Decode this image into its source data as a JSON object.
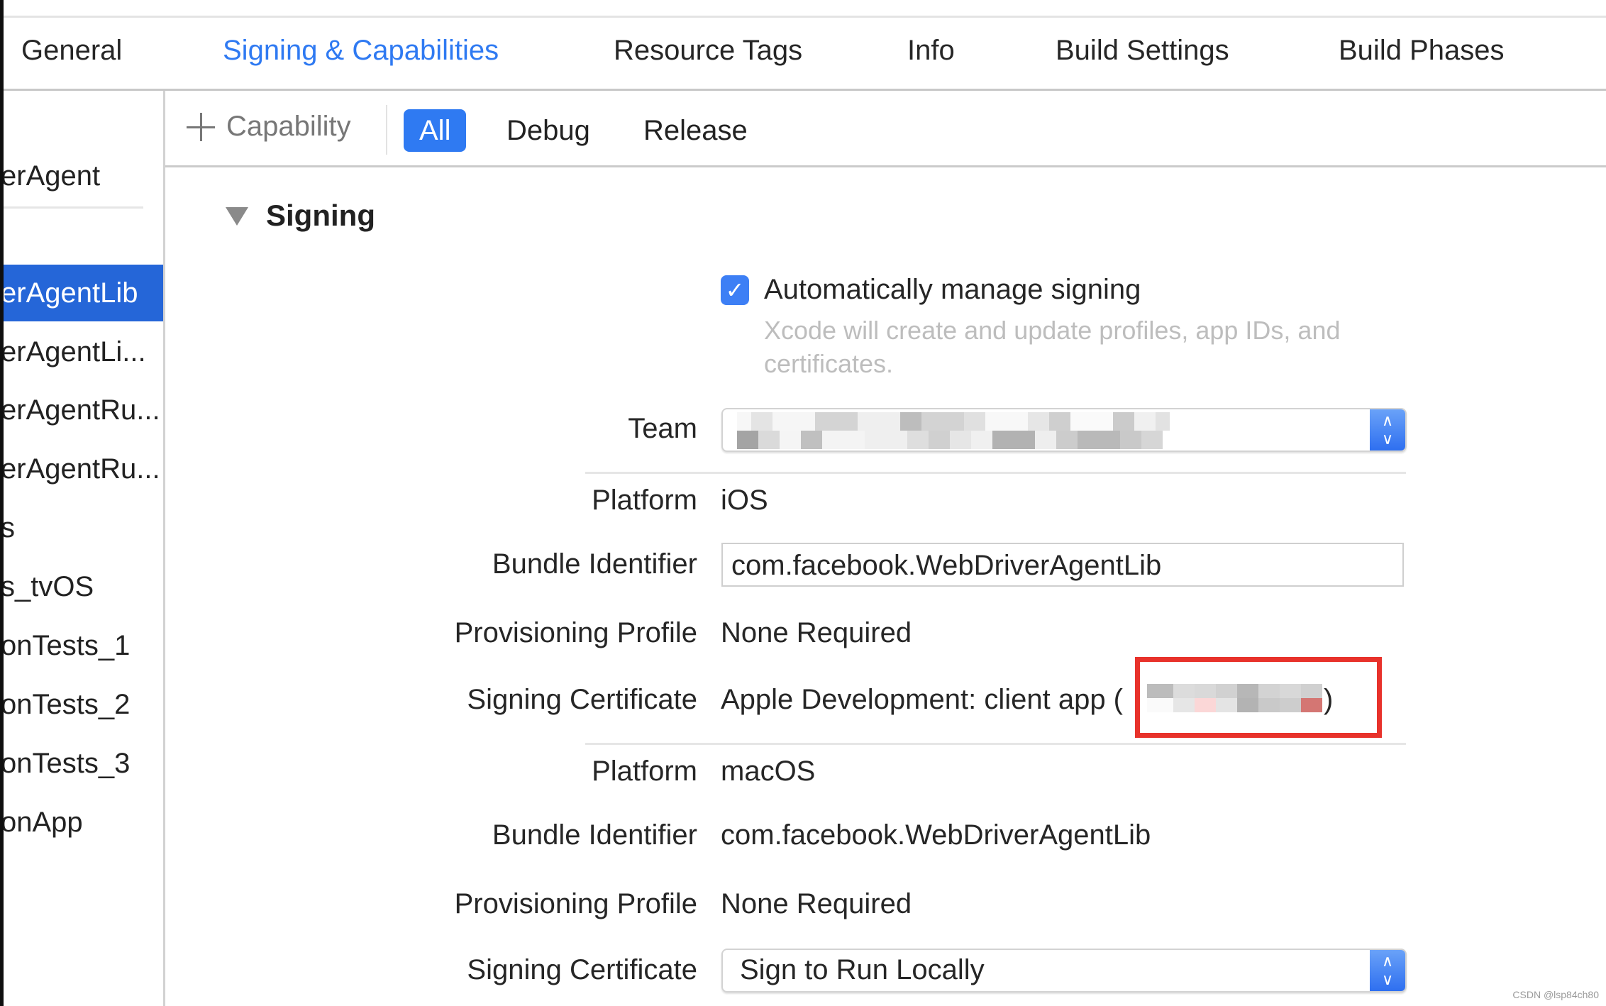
{
  "tabs": [
    {
      "label": "General",
      "active": false
    },
    {
      "label": "Signing & Capabilities",
      "active": true
    },
    {
      "label": "Resource Tags",
      "active": false
    },
    {
      "label": "Info",
      "active": false
    },
    {
      "label": "Build Settings",
      "active": false
    },
    {
      "label": "Build Phases",
      "active": false
    }
  ],
  "sidebar": {
    "project_item": "erAgent",
    "targets": [
      {
        "label": "erAgentLib",
        "selected": true
      },
      {
        "label": "erAgentLi...",
        "selected": false
      },
      {
        "label": "erAgentRu...",
        "selected": false
      },
      {
        "label": "erAgentRu...",
        "selected": false
      },
      {
        "label": "s",
        "selected": false
      },
      {
        "label": "s_tvOS",
        "selected": false
      },
      {
        "label": "onTests_1",
        "selected": false
      },
      {
        "label": "onTests_2",
        "selected": false
      },
      {
        "label": "onTests_3",
        "selected": false
      },
      {
        "label": "onApp",
        "selected": false
      }
    ]
  },
  "toolbar": {
    "add_capability_label": "Capability",
    "filters": [
      {
        "label": "All",
        "active": true
      },
      {
        "label": "Debug",
        "active": false
      },
      {
        "label": "Release",
        "active": false
      }
    ]
  },
  "signing": {
    "section_title": "Signing",
    "auto_manage": {
      "checked": true,
      "check_glyph": "✓",
      "label": "Automatically manage signing",
      "help": "Xcode will create and update profiles, app IDs, and certificates."
    },
    "team": {
      "label": "Team",
      "value": "[redacted]"
    },
    "stepper_up": "∧",
    "stepper_down": "∨",
    "ios": {
      "platform_label": "Platform",
      "platform_value": "iOS",
      "bundle_label": "Bundle Identifier",
      "bundle_value": "com.facebook.WebDriverAgentLib",
      "profile_label": "Provisioning Profile",
      "profile_value": "None Required",
      "cert_label": "Signing Certificate",
      "cert_value": "Apple Development: client app (",
      "cert_suffix": ")"
    },
    "macos": {
      "platform_label": "Platform",
      "platform_value": "macOS",
      "bundle_label": "Bundle Identifier",
      "bundle_value": "com.facebook.WebDriverAgentLib",
      "profile_label": "Provisioning Profile",
      "profile_value": "None Required",
      "cert_label": "Signing Certificate",
      "cert_value": "Sign to Run Locally"
    }
  },
  "colors": {
    "accent": "#2f7af2",
    "selection": "#2566d8",
    "highlight_box": "#e8322b"
  },
  "watermark": "CSDN @lsp84ch80"
}
